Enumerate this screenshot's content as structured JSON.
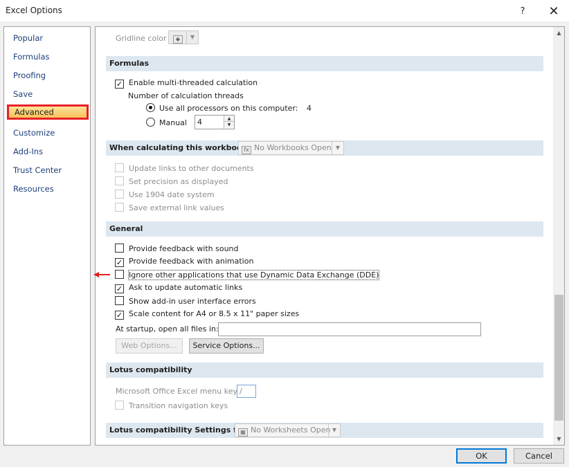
{
  "window": {
    "title": "Excel Options",
    "help": "?",
    "close": "✕"
  },
  "nav": {
    "items": [
      "Popular",
      "Formulas",
      "Proofing",
      "Save",
      "Advanced",
      "Customize",
      "Add-Ins",
      "Trust Center",
      "Resources"
    ],
    "active": "Advanced"
  },
  "gridline": {
    "label": "Gridline color",
    "icon": "paint-bucket-icon"
  },
  "formulas": {
    "header": "Formulas",
    "multithread": {
      "label": "Enable multi-threaded calculation",
      "checked": true
    },
    "threads_label": "Number of calculation threads",
    "use_all": {
      "label": "Use all processors on this computer:",
      "count": "4"
    },
    "manual": {
      "label": "Manual",
      "value": "4"
    }
  },
  "workbook": {
    "header": "When calculating this workbook:",
    "dropdown": "No Workbooks Open",
    "options": [
      {
        "label": "Update links to other documents",
        "checked": false
      },
      {
        "label": "Set precision as displayed",
        "checked": false
      },
      {
        "label": "Use 1904 date system",
        "checked": false
      },
      {
        "label": "Save external link values",
        "checked": false
      }
    ]
  },
  "general": {
    "header": "General",
    "options": [
      {
        "label": "Provide feedback with sound",
        "checked": false
      },
      {
        "label": "Provide feedback with animation",
        "checked": true
      },
      {
        "label": "Ignore other applications that use Dynamic Data Exchange (DDE)",
        "checked": false
      },
      {
        "label": "Ask to update automatic links",
        "checked": true
      },
      {
        "label": "Show add-in user interface errors",
        "checked": false
      },
      {
        "label": "Scale content for A4 or 8.5 x 11\" paper sizes",
        "checked": true
      }
    ],
    "startup_label": "At startup, open all files in:",
    "startup_value": "",
    "web_options": "Web Options...",
    "service_options": "Service Options..."
  },
  "lotus": {
    "header": "Lotus compatibility",
    "menu_key_label": "Microsoft Office Excel menu key:",
    "menu_key_value": "/",
    "transition_keys": {
      "label": "Transition navigation keys",
      "checked": false
    }
  },
  "lotus_settings": {
    "header": "Lotus compatibility Settings for:",
    "dropdown": "No Worksheets Open"
  },
  "footer": {
    "ok": "OK",
    "cancel": "Cancel"
  },
  "colors": {
    "highlight_border": "#e82027",
    "section_bg": "#dde7f0",
    "accent": "#0078d7",
    "annotation_arrow": "#e02020"
  }
}
